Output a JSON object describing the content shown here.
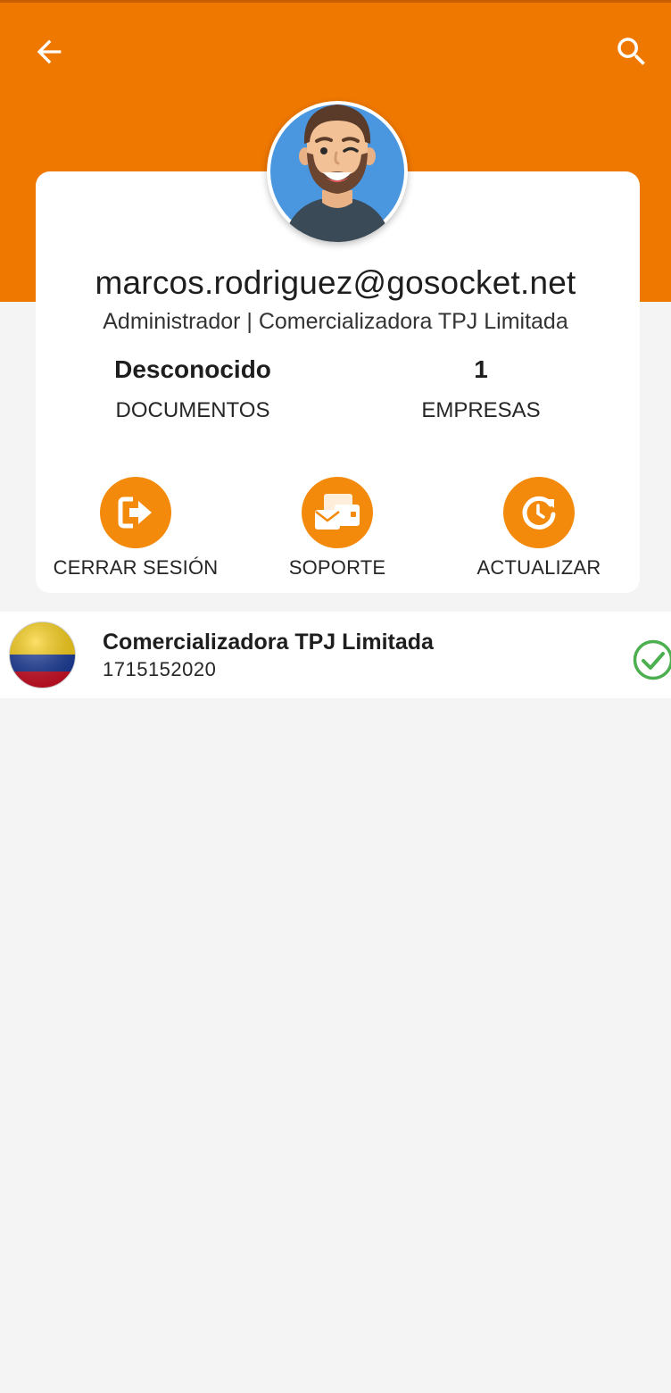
{
  "profile": {
    "email": "marcos.rodriguez@gosocket.net",
    "role_line": "Administrador | Comercializadora TPJ Limitada"
  },
  "stats": {
    "documents": {
      "value": "Desconocido",
      "label": "DOCUMENTOS"
    },
    "companies": {
      "value": "1",
      "label": "EMPRESAS"
    }
  },
  "actions": {
    "logout": {
      "label": "CERRAR SESIÓN",
      "icon": "logout-icon"
    },
    "support": {
      "label": "SOPORTE",
      "icon": "support-mail-icon"
    },
    "refresh": {
      "label": "ACTUALIZAR",
      "icon": "refresh-clock-icon"
    }
  },
  "companies_list": [
    {
      "name": "Comercializadora TPJ Limitada",
      "id": "1715152020",
      "flag": "colombia-flag-icon",
      "selected": true
    }
  ],
  "colors": {
    "header": "#ef7800",
    "accent": "#f48a0b",
    "check_green": "#4caf50",
    "background": "#f4f4f4"
  }
}
